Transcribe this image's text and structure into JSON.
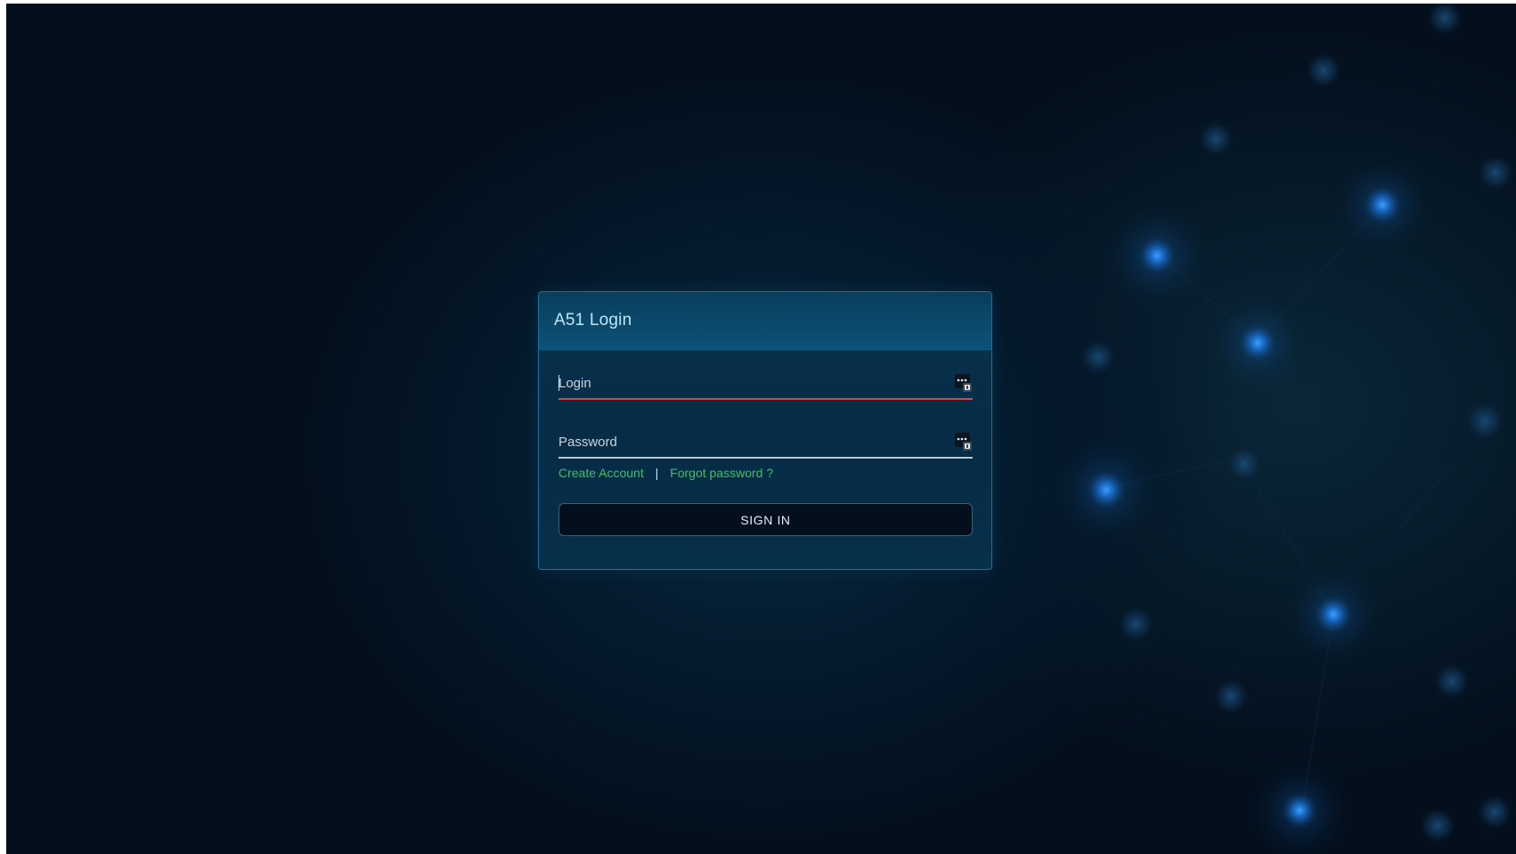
{
  "card": {
    "title": "A51 Login"
  },
  "form": {
    "login_placeholder": "Login",
    "login_value": "",
    "password_placeholder": "Password",
    "password_value": "",
    "links": {
      "create_account": "Create Account",
      "separator": "|",
      "forgot_password": "Forgot password ?"
    },
    "signin_label": "SIGN IN"
  },
  "icons": {
    "field_icon": "password-manager-icon"
  },
  "colors": {
    "background": "#030f1d",
    "card_header": "#0c5277",
    "card_body": "#062c46",
    "accent_link": "#3fbf6a",
    "active_underline": "#e0443e",
    "bokeh": "#1e7fd8"
  }
}
